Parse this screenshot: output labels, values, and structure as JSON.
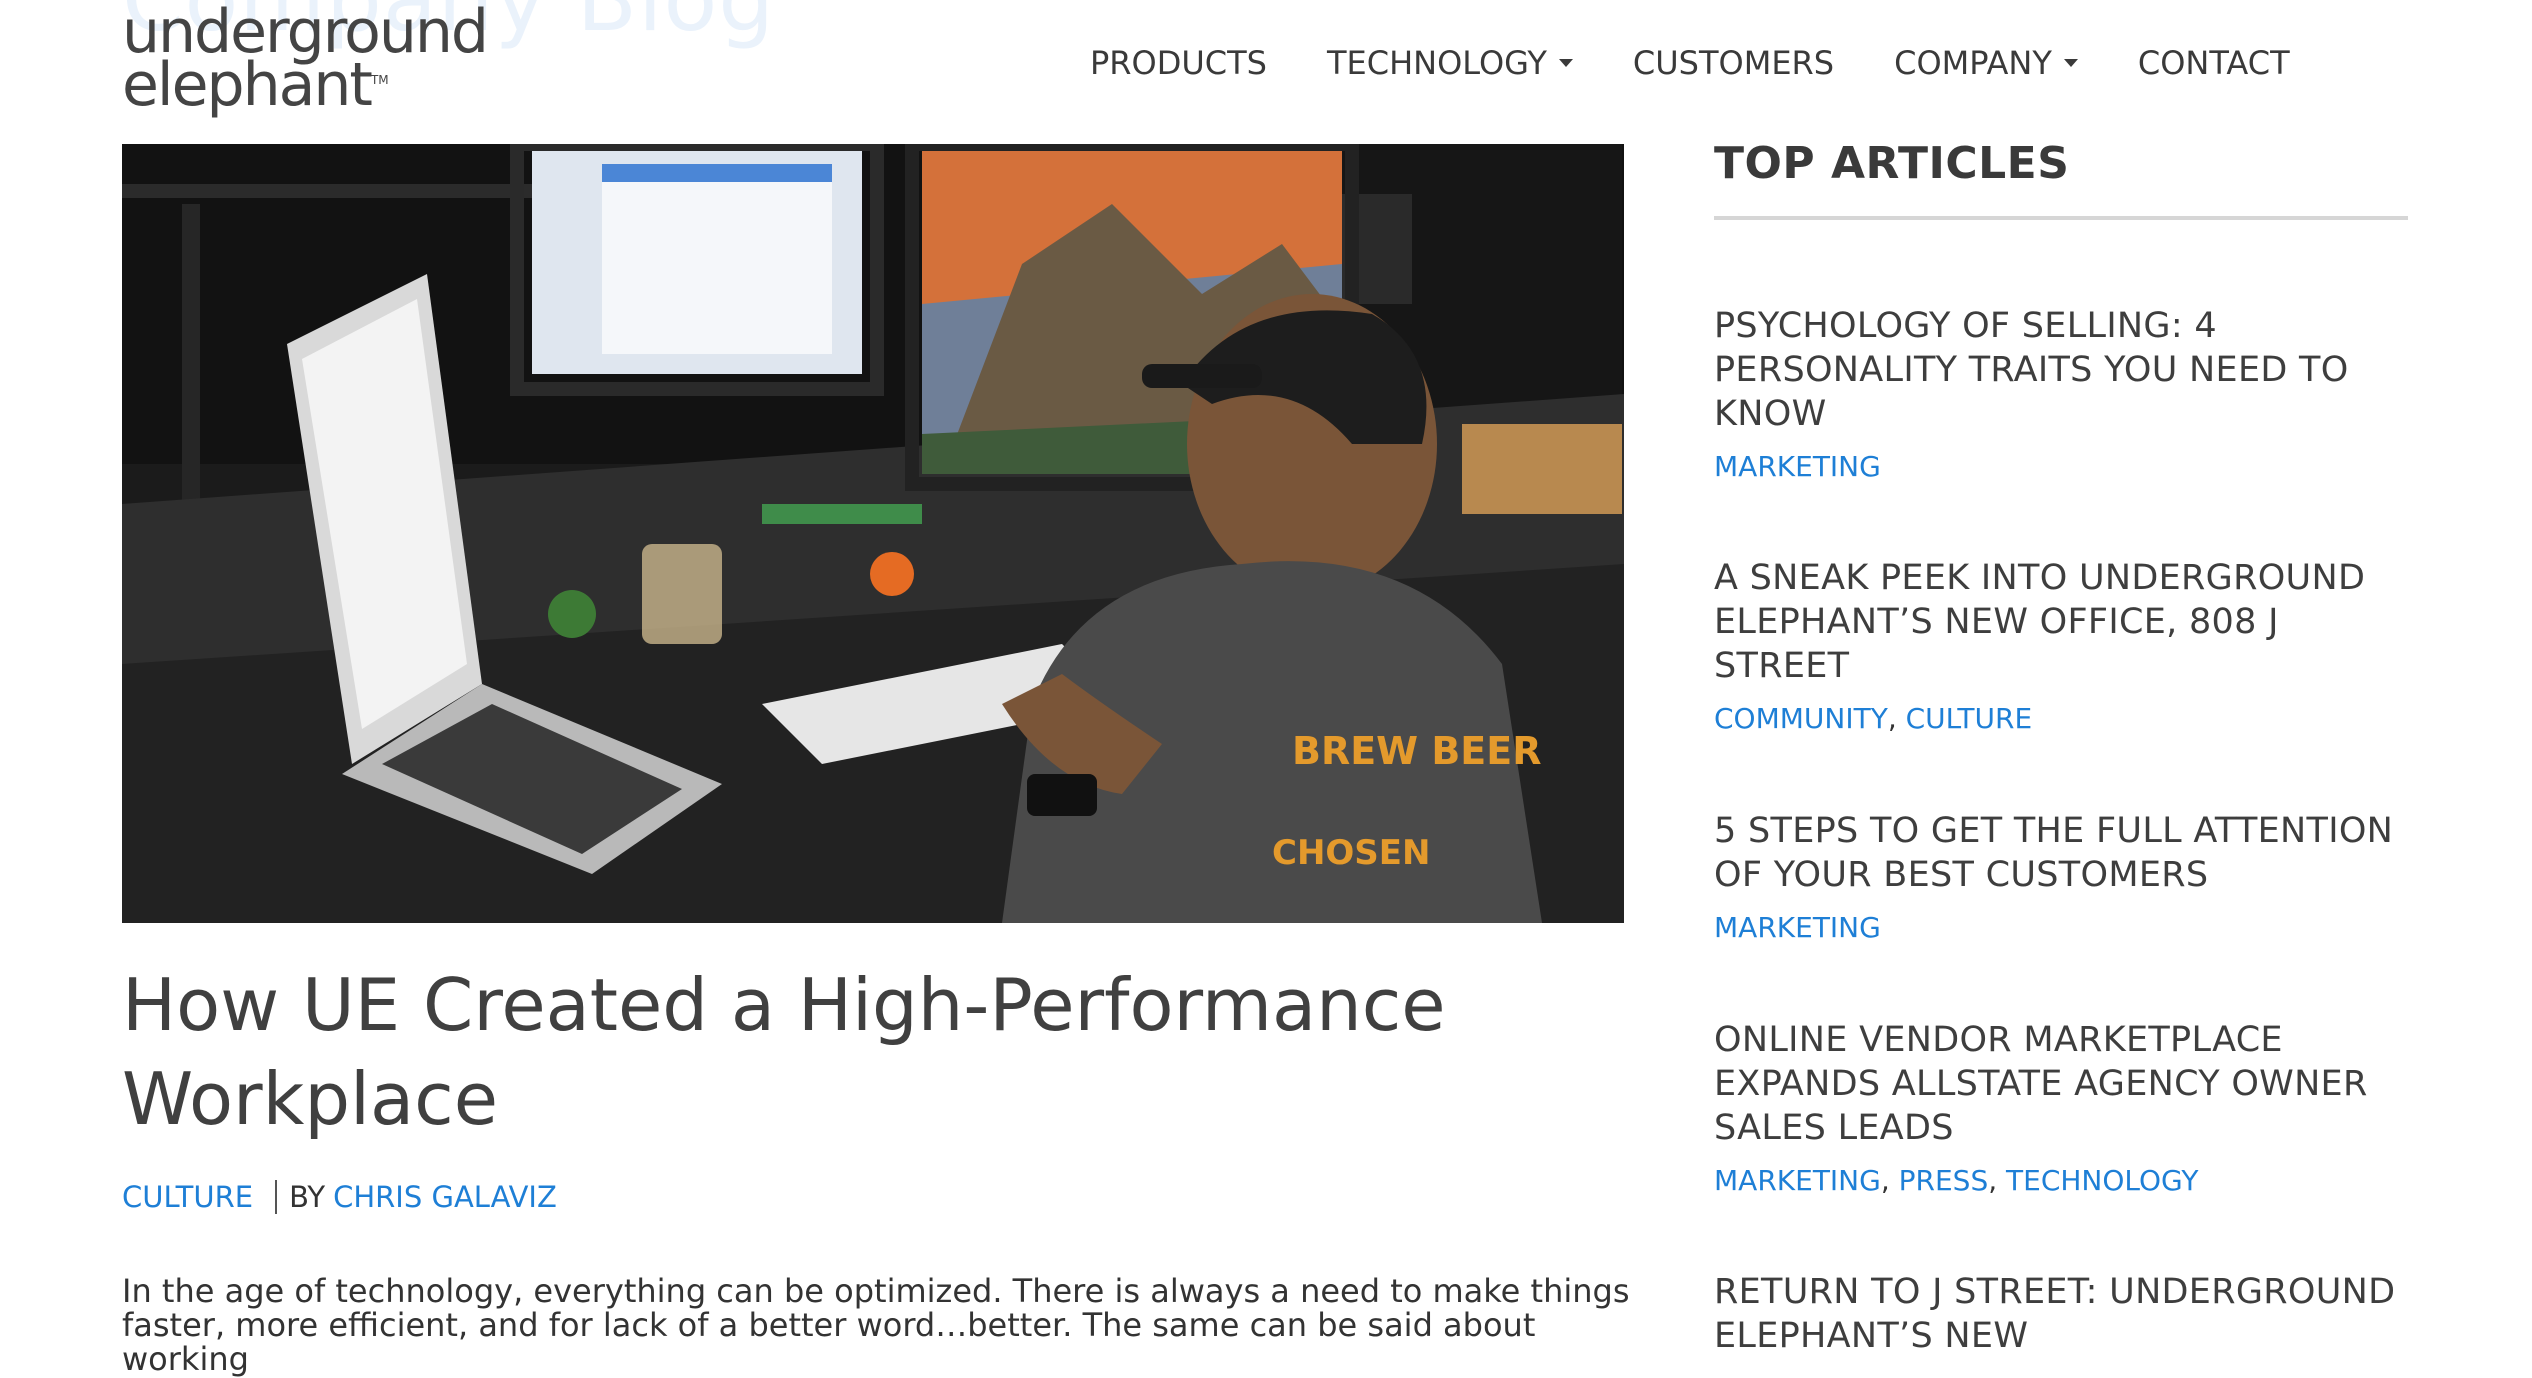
{
  "header": {
    "background_title": "Company Blog",
    "logo": {
      "line1": "underground",
      "line2": "elephant",
      "tm": "TM"
    },
    "nav": [
      {
        "label": "PRODUCTS",
        "dropdown": false
      },
      {
        "label": "TECHNOLOGY",
        "dropdown": true
      },
      {
        "label": "CUSTOMERS",
        "dropdown": false
      },
      {
        "label": "COMPANY",
        "dropdown": true
      },
      {
        "label": "CONTACT",
        "dropdown": false
      }
    ]
  },
  "post": {
    "image_alt": "man working at a desk with a laptop and multiple monitors",
    "title": "How UE Created a High-Performance Workplace",
    "category": "CULTURE",
    "by_label": "BY",
    "author": "CHRIS GALAVIZ",
    "excerpt": "In the age of technology, everything can be optimized.  There is always a need to make things faster, more efficient, and for lack of a better word…better.  The same can be said about working"
  },
  "sidebar": {
    "title": "TOP ARTICLES",
    "articles": [
      {
        "title": "PSYCHOLOGY OF SELLING: 4 PERSONALITY TRAITS YOU NEED TO KNOW",
        "categories": [
          "MARKETING"
        ]
      },
      {
        "title": "A SNEAK PEEK INTO UNDERGROUND ELEPHANT’S NEW OFFICE, 808 J STREET",
        "categories": [
          "COMMUNITY",
          "CULTURE"
        ]
      },
      {
        "title": "5 STEPS TO GET THE FULL ATTENTION OF YOUR BEST CUSTOMERS",
        "categories": [
          "MARKETING"
        ]
      },
      {
        "title": "ONLINE VENDOR MARKETPLACE EXPANDS ALLSTATE AGENCY OWNER SALES LEADS",
        "categories": [
          "MARKETING",
          "PRESS",
          "TECHNOLOGY"
        ]
      },
      {
        "title": "RETURN TO J STREET: UNDERGROUND ELEPHANT’S NEW",
        "categories": []
      }
    ]
  },
  "colors": {
    "link": "#1e7fd6",
    "text": "#404040",
    "rule": "#d6d6d6"
  }
}
